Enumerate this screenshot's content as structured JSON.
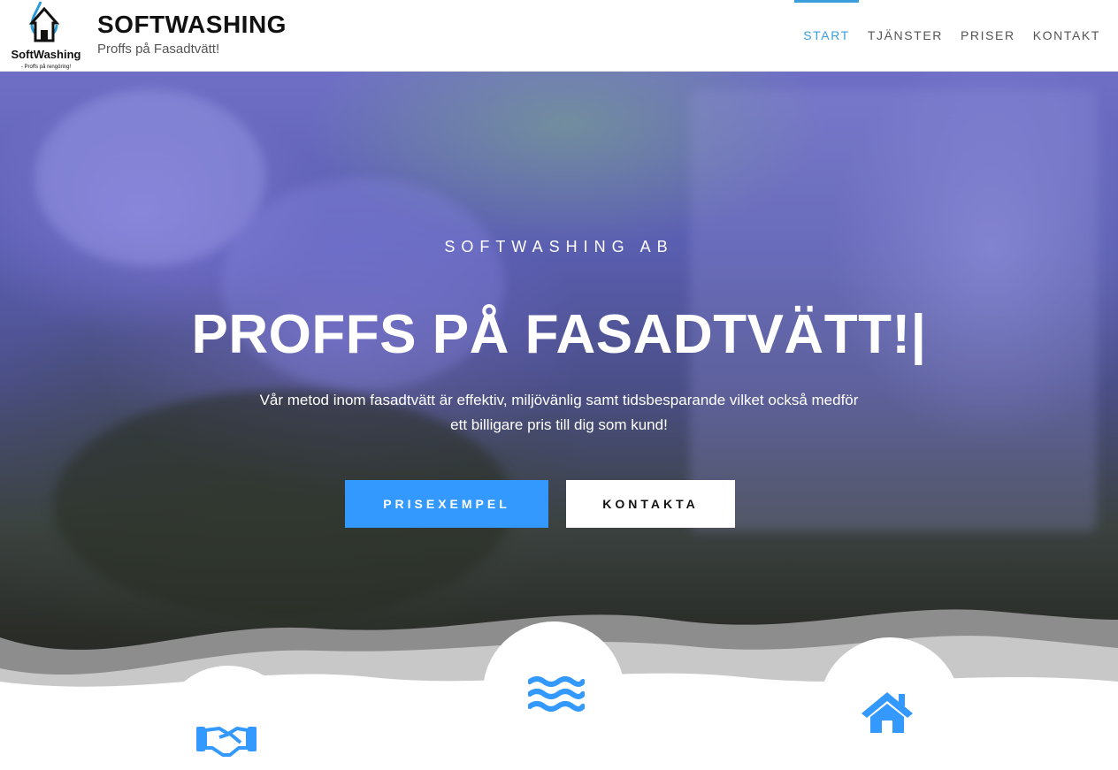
{
  "header": {
    "logo_text": "SoftWashing",
    "logo_subtext": "- Proffs på rengöring!",
    "site_title": "SOFTWASHING",
    "site_tagline": "Proffs på Fasadtvätt!"
  },
  "nav": {
    "items": [
      {
        "label": "START",
        "active": true
      },
      {
        "label": "TJÄNSTER",
        "active": false
      },
      {
        "label": "PRISER",
        "active": false
      },
      {
        "label": "KONTAKT",
        "active": false
      }
    ]
  },
  "hero": {
    "eyebrow": "SOFTWASHING AB",
    "title": "PROFFS PÅ FASADTVÄTT!|",
    "text": "Vår metod inom fasadtvätt är effektiv, miljövänlig samt tidsbesparande vilket också medför ett billigare pris till dig som kund!",
    "primary_button": "PRISEXEMPEL",
    "secondary_button": "KONTAKTA"
  },
  "features": {
    "icons": [
      "handshake-icon",
      "water-waves-icon",
      "house-icon"
    ]
  },
  "colors": {
    "accent": "#3a9edc",
    "button_blue": "#3399ff",
    "icon_blue": "#3399ff"
  }
}
